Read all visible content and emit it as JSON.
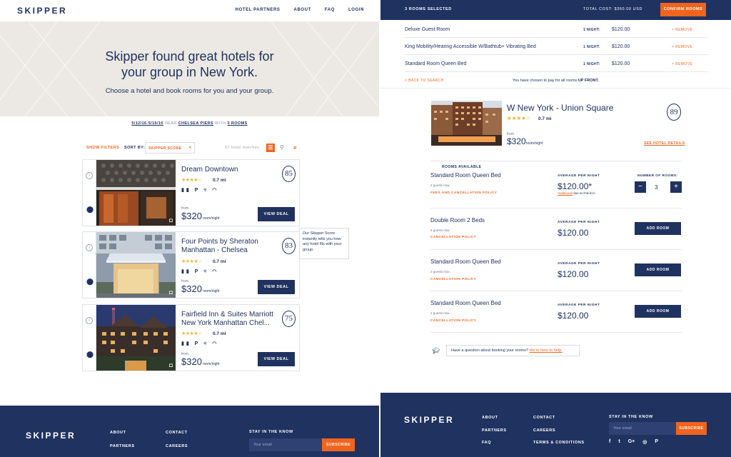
{
  "left": {
    "logo": "SKIPPER",
    "nav": [
      "HOTEL PARTNERS",
      "ABOUT",
      "FAQ",
      "LOGIN"
    ],
    "hero": {
      "title": "Skipper found great hotels for your group in New York.",
      "subtitle": "Choose a hotel and book rooms for you and your group."
    },
    "search": {
      "dates": "5/12/16-5/16/16",
      "near_label": "NEAR",
      "near": "CHELSEA PIERS",
      "with_label": "WITH",
      "rooms": "3 ROOMS"
    },
    "filters": {
      "show_filters": "SHOW FILTERS",
      "sort_by": "SORT BY:",
      "sort_value": "SKIPPER SCORE",
      "matches": "97 hotel matches"
    },
    "hotels": [
      {
        "name": "Dream Downtown",
        "score": "85",
        "stars": "★★★★☆",
        "distance": "0.7 mi",
        "amenities": "▮▮ P ⑂ ◠",
        "from": "from",
        "price": "$320",
        "unit": "room/night",
        "cta": "VIEW DEAL"
      },
      {
        "name": "Four Points by Sheraton Manhattan - Chelsea",
        "score": "83",
        "stars": "★★★★☆",
        "distance": "0.7 mi",
        "amenities": "▮▮ P ⑂ ◠",
        "from": "from",
        "price": "$320",
        "unit": "room/night",
        "cta": "VIEW DEAL"
      },
      {
        "name": "Fairfield Inn & Suites Marriott New York Manhattan Chel...",
        "score": "75",
        "stars": "★★★★☆",
        "distance": "0.7 mi",
        "amenities": "▮▮ P ⑂ ◠",
        "from": "from",
        "price": "$320",
        "unit": "room/night",
        "cta": "VIEW DEAL"
      }
    ],
    "tooltip": "Our Skipper Score instantly tells you how any hotel fits with your group.",
    "footer": {
      "logo": "SKIPPER",
      "col1": [
        "ABOUT",
        "PARTNERS"
      ],
      "col2": [
        "CONTACT",
        "CAREERS"
      ],
      "newsletter": "STAY IN THE KNOW",
      "email_placeholder": "Your email",
      "subscribe": "SUBSCRIBE"
    }
  },
  "right": {
    "topbar": {
      "selected": "3 ROOMS SELECTED",
      "total": "TOTAL COST: $360.00 USD",
      "confirm": "CONFIRM ROOMS"
    },
    "selected_rooms": [
      {
        "name": "Deluxe Guest Room",
        "nights": "1 NIGHT:",
        "price": "$120.00",
        "remove": "× REMOVE"
      },
      {
        "name": "King Mobility/Hearing Accessible W/Bathtub+ Vibrating Bed",
        "nights": "1 NIGHT:",
        "price": "$120.00",
        "remove": "× REMOVE"
      },
      {
        "name": "Standard Room Queen Bed",
        "nights": "1 NIGHT:",
        "price": "$120.00",
        "remove": "× REMOVE"
      }
    ],
    "back": "< BACK TO SEARCH",
    "pay_note": "You have chosen to pay for all rooms",
    "pay_note_bold": "UP FRONT.",
    "hotel": {
      "name": "W New York - Union Square",
      "stars": "★★★★☆",
      "distance": "0.7 mi",
      "score": "89",
      "from": "from",
      "price": "$320",
      "unit": "room/night",
      "details": "SEE HOTEL DETAILS"
    },
    "rooms_available": "ROOMS AVAILABLE",
    "rooms": [
      {
        "name": "Standard Room Queen Bed",
        "guests": "2 guests max",
        "policy": "FEES AND CANCELLATION POLICY",
        "apn": "AVERAGE PER NIGHT",
        "price": "$120.00*",
        "num_label": "NUMBER OF ROOMS:",
        "qty": "3",
        "tax_link": "*additional",
        "tax_text": "due at check-in"
      },
      {
        "name": "Double Room 2 Beds",
        "guests": "4 guests max",
        "policy": "CANCELLATION POLICY",
        "apn": "AVERAGE PER NIGHT",
        "price": "$120.00",
        "cta": "ADD ROOM"
      },
      {
        "name": "Standard Room Queen Bed",
        "guests": "2 guests max",
        "policy": "CANCELLATION POLICY",
        "apn": "AVERAGE PER NIGHT",
        "price": "$120.00",
        "cta": "ADD ROOM"
      },
      {
        "name": "Standard Room Queen Bed",
        "guests": "2 guests max",
        "policy": "CANCELLATION POLICY",
        "apn": "AVERAGE PER NIGHT",
        "price": "$120.00",
        "cta": "ADD ROOM"
      }
    ],
    "help": {
      "text": "Have a question about booking your rooms?",
      "link": "We're here to help."
    },
    "footer": {
      "logo": "SKIPPER",
      "col1": [
        "ABOUT",
        "PARTNERS",
        "FAQ"
      ],
      "col2": [
        "CONTACT",
        "CAREERS",
        "TERMS & CONDITIONS"
      ],
      "newsletter": "STAY IN THE KNOW",
      "email_placeholder": "Your email",
      "subscribe": "SUBSCRIBE",
      "social": [
        "f",
        "t",
        "G+",
        "◎",
        "P"
      ]
    }
  },
  "colors": {
    "navy": "#1f3260",
    "orange": "#f0641e",
    "hero_bg": "#ece9e4",
    "star": "#f4b321"
  }
}
